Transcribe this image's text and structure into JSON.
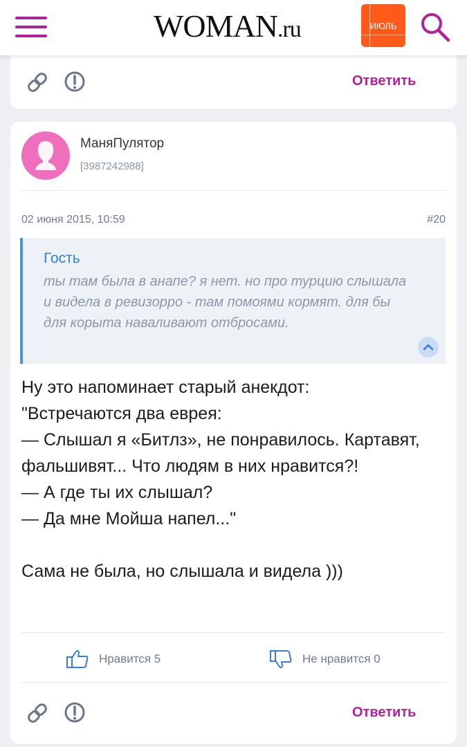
{
  "header": {
    "logo_main": "WOMAN",
    "logo_suffix": ".ru",
    "month_badge": "ИЮЛЬ",
    "menu_icon": "hamburger-icon",
    "search_icon": "search-icon",
    "accent_color": "#b2219c",
    "badge_color": "#ff5a1a"
  },
  "previous_comment": {
    "reply_label": "Ответить",
    "icons": [
      "link-icon",
      "complaint-icon"
    ]
  },
  "comment": {
    "username": "МаняПулятор",
    "user_id": "[3987242988]",
    "date": "02 июня 2015, 10:59",
    "number": "#20",
    "quote": {
      "author": "Гость",
      "text": "ты там была в анапе? я нет. но про турцию слышала и видела в ревизорро - там помоями кормят. для бы для корыта наваливают отбросами."
    },
    "body": "Ну это напоминает старый анекдот:\n\"Встречаются два еврея:\n— Слышал я «Битлз», не понравилось. Картавят, фальшивят... Что людям в них нравится?!\n— А где ты их слышал?\n— Да мне Мойша напел...\"\n\nСама не была, но слышала и видела )))",
    "like_label": "Нравится 5",
    "dislike_label": "Не нравится 0",
    "reply_label": "Ответить",
    "quote_color": "#2e7fd6"
  }
}
